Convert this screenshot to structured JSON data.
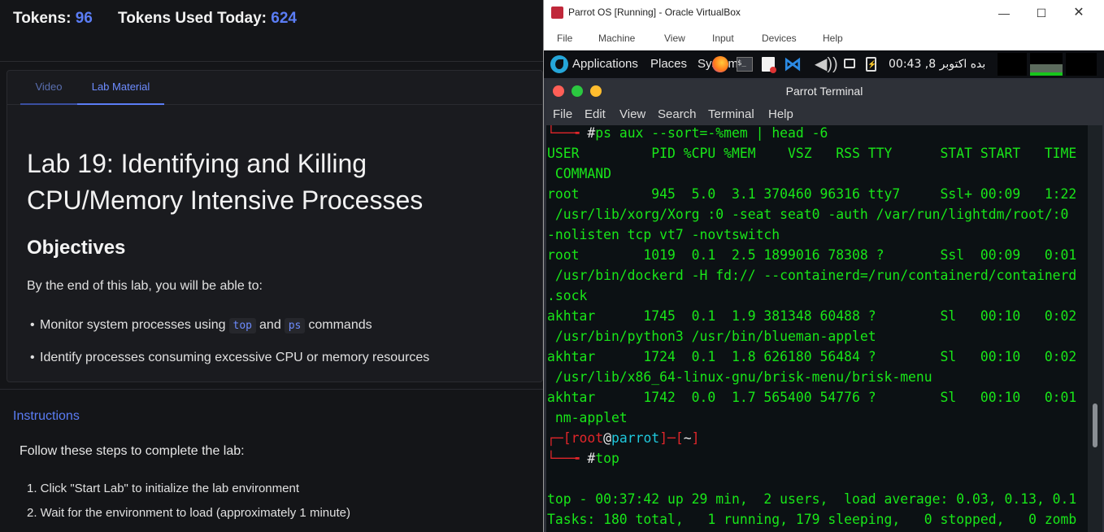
{
  "lab_panel": {
    "tokens_label": "Tokens:",
    "tokens_value": "96",
    "tokens_today_label": "Tokens Used Today:",
    "tokens_today_value": "624",
    "tabs": [
      {
        "label": "Video",
        "active": false
      },
      {
        "label": "Lab Material",
        "active": true
      }
    ],
    "title": "Lab 19: Identifying and Killing CPU/Memory Intensive Processes",
    "objectives_heading": "Objectives",
    "objectives_intro": "By the end of this lab, you will be able to:",
    "objective_1": {
      "pre": "Monitor system processes using",
      "code1": "top",
      "mid": "and",
      "code2": "ps",
      "post": "commands"
    },
    "objective_2": "Identify processes consuming excessive CPU or memory resources",
    "instructions_heading": "Instructions",
    "instructions_intro": "Follow these steps to complete the lab:",
    "steps": [
      "1. Click \"Start Lab\" to initialize the lab environment",
      "2. Wait for the environment to load (approximately 1 minute)"
    ],
    "accent_color": "#5b7df5"
  },
  "vbox": {
    "title": "Parrot OS [Running] - Oracle VirtualBox",
    "menu": [
      "File",
      "Machine",
      "View",
      "Input",
      "Devices",
      "Help"
    ],
    "window_controls": {
      "minimize": "—",
      "maximize": "☐",
      "close": "✕"
    }
  },
  "guest_panel": {
    "menus": [
      "Applications",
      "Places",
      "System"
    ],
    "clock": "00:43 ,8 بده اکتوبر",
    "icons": [
      "parrot-logo-icon",
      "firefox-icon",
      "terminal-icon",
      "files-icon",
      "vscode-icon",
      "volume-icon",
      "display-icon",
      "battery-icon"
    ]
  },
  "terminal": {
    "title": "Parrot Terminal",
    "menu": [
      "File",
      "Edit",
      "View",
      "Search",
      "Terminal",
      "Help"
    ],
    "prompt": {
      "open": "┌─[",
      "user": "root",
      "at": "@",
      "host": "parrot",
      "sep": "]─[",
      "dir": "~",
      "close": "]",
      "arrow": "└──╼ ",
      "hash": "#"
    },
    "command_1": "ps aux --sort=-%mem | head -6",
    "lines": [
      "USER         PID %CPU %MEM    VSZ   RSS TTY      STAT START   TIME",
      " COMMAND",
      "root         945  5.0  3.1 370460 96316 tty7     Ssl+ 00:09   1:22",
      " /usr/lib/xorg/Xorg :0 -seat seat0 -auth /var/run/lightdm/root/:0",
      "-nolisten tcp vt7 -novtswitch",
      "root        1019  0.1  2.5 1899016 78308 ?       Ssl  00:09   0:01",
      " /usr/bin/dockerd -H fd:// --containerd=/run/containerd/containerd",
      ".sock",
      "akhtar      1745  0.1  1.9 381348 60488 ?        Sl   00:10   0:02",
      " /usr/bin/python3 /usr/bin/blueman-applet",
      "akhtar      1724  0.1  1.8 626180 56484 ?        Sl   00:10   0:02",
      " /usr/lib/x86_64-linux-gnu/brisk-menu/brisk-menu",
      "akhtar      1742  0.0  1.7 565400 54776 ?        Sl   00:10   0:01",
      " nm-applet"
    ],
    "command_2": "top",
    "top_lines": [
      "top - 00:37:42 up 29 min,  2 users,  load average: 0.03, 0.13, 0.1",
      "Tasks: 180 total,   1 running, 179 sleeping,   0 stopped,   0 zomb"
    ],
    "text_color": "#19e619",
    "prompt_color": "#e0262a",
    "host_color": "#1fc8dc"
  }
}
